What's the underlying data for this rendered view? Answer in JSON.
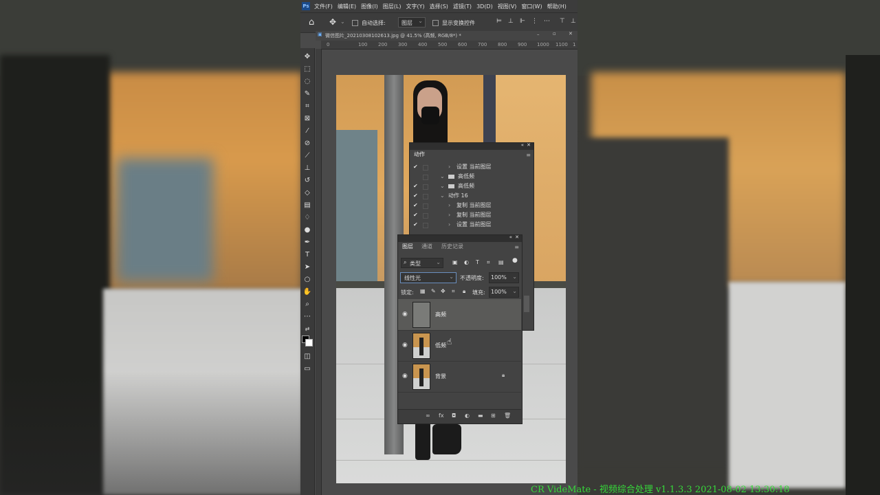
{
  "menu": {
    "ps_icon": "Ps",
    "items": [
      "文件(F)",
      "编辑(E)",
      "图像(I)",
      "图层(L)",
      "文字(Y)",
      "选择(S)",
      "滤镜(T)",
      "3D(D)",
      "视图(V)",
      "窗口(W)",
      "帮助(H)"
    ]
  },
  "options": {
    "auto_select_label": "自动选择:",
    "auto_select_value": "图层",
    "show_transform_label": "显示变换控件"
  },
  "document_tab": {
    "title": "微信图片_20210308102613.jpg @ 41.5% (高频, RGB/8*) *"
  },
  "ruler": {
    "ticks": [
      "0",
      "100",
      "200",
      "300",
      "400",
      "500",
      "600",
      "700",
      "800",
      "900",
      "1000",
      "1100",
      "1"
    ]
  },
  "actions_panel": {
    "tab": "动作",
    "rows": [
      {
        "check": "✔",
        "indent": 3,
        "arrow": "›",
        "folder": false,
        "text": "设置 当前图层"
      },
      {
        "check": "",
        "indent": 2,
        "arrow": "⌄",
        "folder": true,
        "text": "高低频"
      },
      {
        "check": "✔",
        "indent": 2,
        "arrow": "⌄",
        "folder": true,
        "text": "高低频"
      },
      {
        "check": "✔",
        "indent": 2,
        "arrow": "⌄",
        "folder": false,
        "text": "动作 16"
      },
      {
        "check": "✔",
        "indent": 3,
        "arrow": "›",
        "folder": false,
        "text": "复制 当前图层"
      },
      {
        "check": "✔",
        "indent": 3,
        "arrow": "›",
        "folder": false,
        "text": "复制 当前图层"
      },
      {
        "check": "✔",
        "indent": 3,
        "arrow": "›",
        "folder": false,
        "text": "设置 当前图层"
      }
    ]
  },
  "layers_panel": {
    "tabs": [
      "图层",
      "通道",
      "历史记录"
    ],
    "filter_label": "类型",
    "blend_mode": "线性光",
    "opacity_label": "不透明度:",
    "opacity_value": "100%",
    "lock_label": "锁定:",
    "fill_label": "填充:",
    "fill_value": "100%",
    "layers": [
      {
        "name": "高频",
        "selected": true,
        "locked": false,
        "thumb": "gray"
      },
      {
        "name": "低频",
        "selected": false,
        "locked": false,
        "thumb": "photo"
      },
      {
        "name": "背景",
        "selected": false,
        "locked": true,
        "thumb": "photo"
      }
    ],
    "footer_icons": [
      "link-icon",
      "fx-icon",
      "mask-icon",
      "adjustment-icon",
      "group-folder-icon",
      "new-layer-icon",
      "trash-icon"
    ],
    "footer_glyphs": [
      "∞",
      "fx",
      "◘",
      "◐",
      "▬",
      "⊞",
      "🗑"
    ]
  },
  "watermark": "CR VideMate - 视频综合处理 v1.1.3.3 2021-08-02 13:30:18",
  "colors": {
    "watermark": "#36d93a",
    "panel_bg": "#434343",
    "selected_layer": "#5a5a58"
  }
}
